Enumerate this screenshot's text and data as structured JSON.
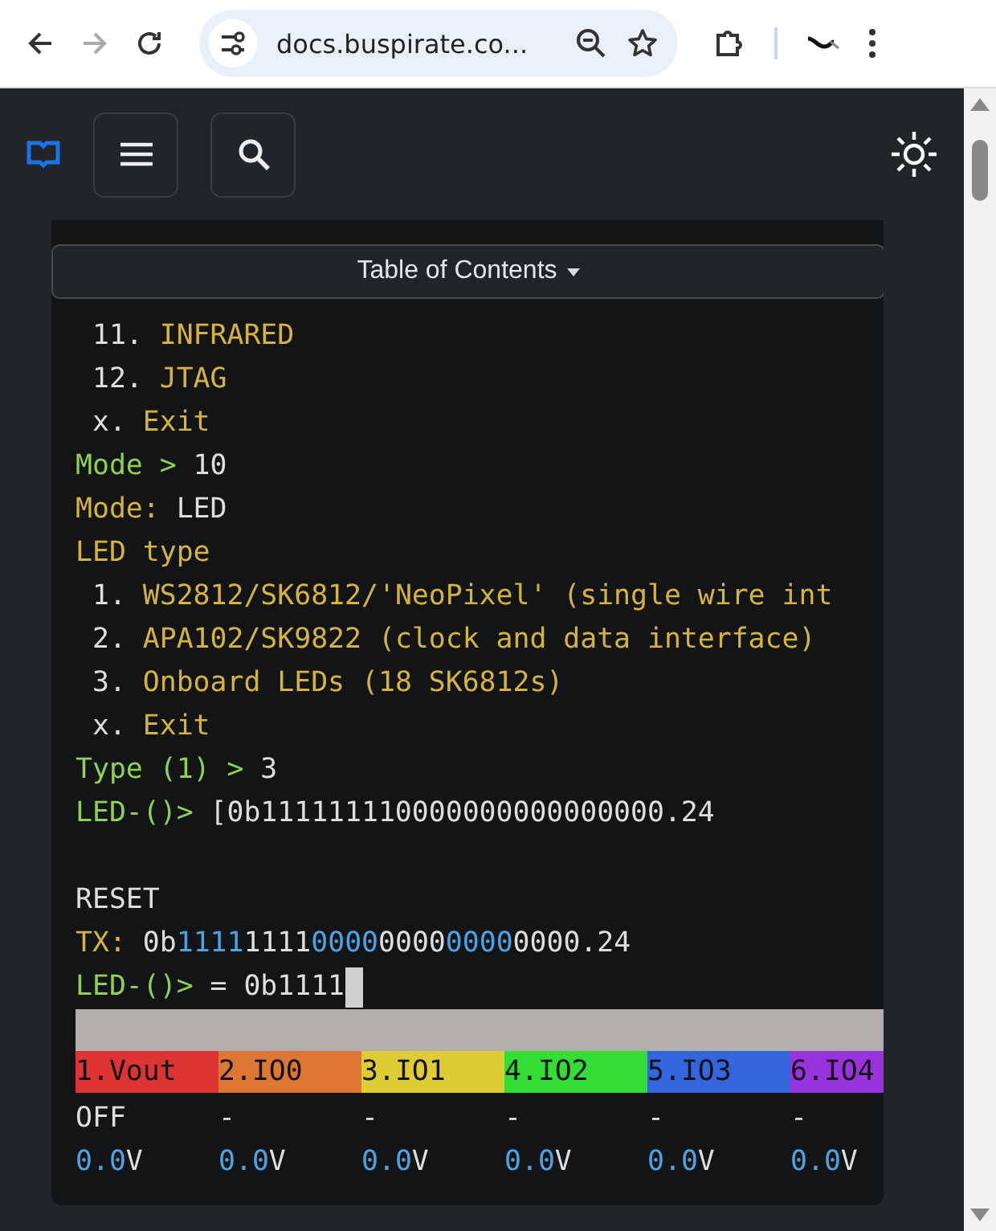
{
  "browser": {
    "url": "docs.buspirate.co...",
    "forward_disabled": true
  },
  "toc": {
    "label": "Table of Contents"
  },
  "terminal": {
    "lines": [
      {
        "segments": [
          {
            "text": " 11. ",
            "kind": "plain"
          },
          {
            "text": "INFRARED",
            "kind": "label"
          }
        ]
      },
      {
        "segments": [
          {
            "text": " 12. ",
            "kind": "plain"
          },
          {
            "text": "JTAG",
            "kind": "label"
          }
        ]
      },
      {
        "segments": [
          {
            "text": " x. ",
            "kind": "plain"
          },
          {
            "text": "Exit",
            "kind": "label"
          }
        ]
      },
      {
        "segments": [
          {
            "text": "Mode > ",
            "kind": "prompt"
          },
          {
            "text": "10",
            "kind": "plain"
          }
        ]
      },
      {
        "segments": [
          {
            "text": "Mode: ",
            "kind": "label"
          },
          {
            "text": "LED",
            "kind": "plain"
          }
        ]
      },
      {
        "segments": [
          {
            "text": "LED type",
            "kind": "label"
          }
        ]
      },
      {
        "segments": [
          {
            "text": " 1. ",
            "kind": "plain"
          },
          {
            "text": "WS2812/SK6812/'NeoPixel' (single wire int",
            "kind": "label"
          }
        ]
      },
      {
        "segments": [
          {
            "text": " 2. ",
            "kind": "plain"
          },
          {
            "text": "APA102/SK9822 (clock and data interface)",
            "kind": "label"
          }
        ]
      },
      {
        "segments": [
          {
            "text": " 3. ",
            "kind": "plain"
          },
          {
            "text": "Onboard LEDs (18 SK6812s)",
            "kind": "label"
          }
        ]
      },
      {
        "segments": [
          {
            "text": " x. ",
            "kind": "plain"
          },
          {
            "text": "Exit",
            "kind": "label"
          }
        ]
      },
      {
        "segments": [
          {
            "text": "Type (1) > ",
            "kind": "prompt"
          },
          {
            "text": "3",
            "kind": "plain"
          }
        ]
      },
      {
        "segments": [
          {
            "text": "LED-()> ",
            "kind": "prompt"
          },
          {
            "text": "[0b111111110000000000000000.24",
            "kind": "plain"
          }
        ]
      }
    ],
    "output_lines": [
      {
        "cursor": false,
        "segments": [
          {
            "text": "RESET",
            "kind": "plain"
          }
        ]
      },
      {
        "cursor": false,
        "segments": [
          {
            "text": "TX: ",
            "kind": "label"
          },
          {
            "text": "0b",
            "kind": "plain"
          },
          {
            "text": "1111",
            "kind": "value"
          },
          {
            "text": "1111",
            "kind": "plain"
          },
          {
            "text": "0000",
            "kind": "value"
          },
          {
            "text": "0000",
            "kind": "plain"
          },
          {
            "text": "0000",
            "kind": "value"
          },
          {
            "text": "0000.24",
            "kind": "plain"
          }
        ]
      },
      {
        "cursor": true,
        "segments": [
          {
            "text": "LED-()> ",
            "kind": "prompt"
          },
          {
            "text": "= 0b1111",
            "kind": "plain"
          }
        ]
      }
    ],
    "pins": [
      {
        "name": "1.Vout",
        "color": "#dd3333",
        "state": "OFF",
        "volts": "0.0",
        "unit": "V"
      },
      {
        "name": "2.IO0",
        "color": "#dd7733",
        "state": "-",
        "volts": "0.0",
        "unit": "V"
      },
      {
        "name": "3.IO1",
        "color": "#ddcc33",
        "state": "-",
        "volts": "0.0",
        "unit": "V"
      },
      {
        "name": "4.IO2",
        "color": "#33dd33",
        "state": "-",
        "volts": "0.0",
        "unit": "V"
      },
      {
        "name": "5.IO3",
        "color": "#3366dd",
        "state": "-",
        "volts": "0.0",
        "unit": "V"
      },
      {
        "name": "6.IO4",
        "color": "#9933dd",
        "state": "-",
        "volts": "0.0",
        "unit": "V"
      }
    ]
  }
}
